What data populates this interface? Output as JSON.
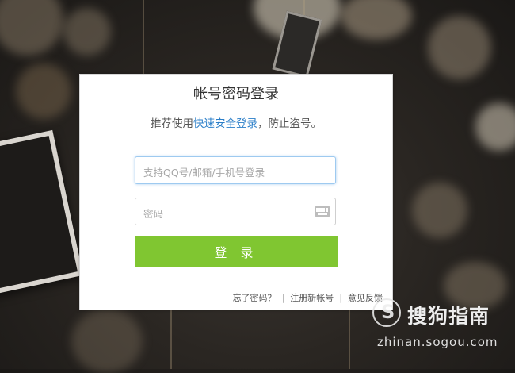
{
  "dialog": {
    "title": "帐号密码登录",
    "subtitle_prefix": "推荐使用",
    "subtitle_link": "快速安全登录",
    "subtitle_suffix": "，防止盗号。",
    "account_placeholder": "支持QQ号/邮箱/手机号登录",
    "password_placeholder": "密码",
    "login_button": "登 录",
    "links": {
      "forgot_password": "忘了密码？",
      "register": "注册新帐号",
      "feedback": "意见反馈"
    }
  },
  "watermark": {
    "logo_glyph": "S",
    "name": "搜狗指南",
    "url": "zhinan.sogou.com"
  },
  "colors": {
    "accent_green": "#80c631",
    "link_blue": "#2a7ec8",
    "focus_border": "#9ecaf0"
  },
  "icons": {
    "keyboard": "keyboard-icon"
  }
}
